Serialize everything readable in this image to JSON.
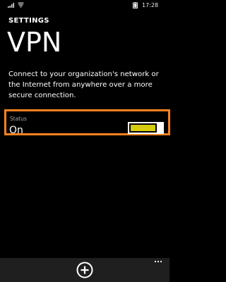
{
  "status_bar": {
    "signal_icon": "signal-bars-icon",
    "wifi_icon": "wifi-icon",
    "battery_icon": "battery-icon",
    "time": "17:28"
  },
  "header": {
    "section": "SETTINGS",
    "title": "VPN"
  },
  "description": "Connect to your organization's network or the Internet from anywhere over a more secure connection.",
  "status": {
    "label": "Status",
    "value": "On",
    "toggle_on": true
  },
  "colors": {
    "background": "#000000",
    "highlight_border": "#f6821f",
    "toggle_accent": "#d6cb0d",
    "app_bar": "#1f1f1f"
  },
  "app_bar": {
    "add_icon": "add-circle-icon",
    "more_icon": "more-ellipsis-icon"
  }
}
